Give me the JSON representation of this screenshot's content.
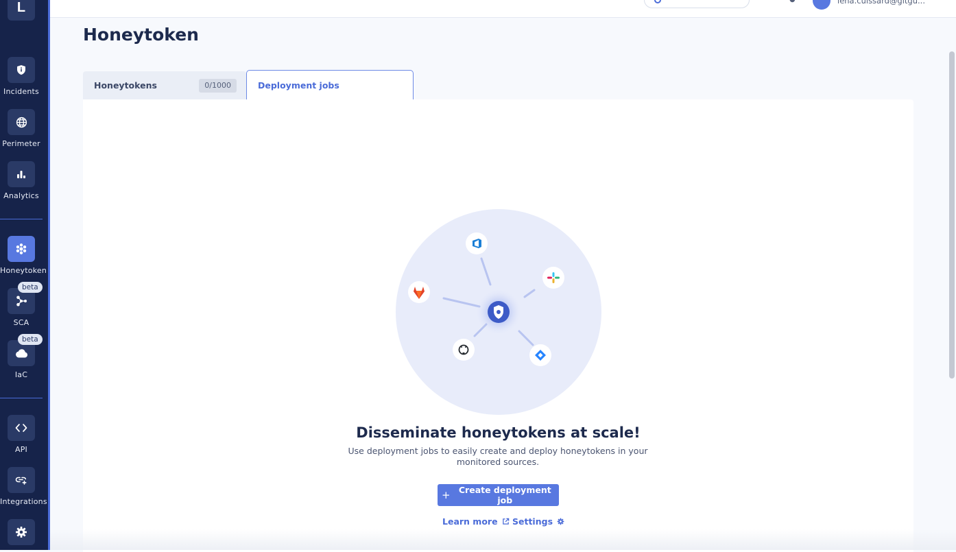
{
  "app": {
    "logo_letter": "L"
  },
  "sidebar": {
    "items": [
      {
        "label": "Incidents",
        "icon": "shield-icon"
      },
      {
        "label": "Perimeter",
        "icon": "globe-icon"
      },
      {
        "label": "Analytics",
        "icon": "bar-chart-icon"
      },
      {
        "label": "Honeytoken",
        "icon": "honeycomb-icon",
        "active": true
      },
      {
        "label": "SCA",
        "icon": "graph-nodes-icon",
        "badge": "beta"
      },
      {
        "label": "IaC",
        "icon": "cloud-icon",
        "badge": "beta"
      },
      {
        "label": "API",
        "icon": "code-brackets-icon"
      },
      {
        "label": "Integrations",
        "icon": "link-plus-icon"
      },
      {
        "label": "",
        "icon": "gear-icon"
      }
    ]
  },
  "topbar": {
    "user_email": "lena.cuissard@gitgu..."
  },
  "page": {
    "title": "Honeytoken"
  },
  "tabs": {
    "honeytokens_label": "Honeytokens",
    "honeytokens_count": "0/1000",
    "deployment_label": "Deployment jobs",
    "active": "Deployment jobs"
  },
  "empty_state": {
    "title": "Disseminate honeytokens at scale!",
    "description": "Use deployment jobs to easily create and deploy honeytokens in your monitored sources.",
    "create_button": "Create deployment job",
    "learn_more": "Learn more",
    "settings": "Settings",
    "source_icons": [
      "azure-devops-icon",
      "slack-icon",
      "gitlab-icon",
      "github-icon",
      "jira-icon"
    ]
  },
  "colors": {
    "sidebar_bg": "#16234a",
    "accent": "#5878e0",
    "accent_text": "#4a6bd8",
    "page_bg": "#f7f9fd"
  }
}
